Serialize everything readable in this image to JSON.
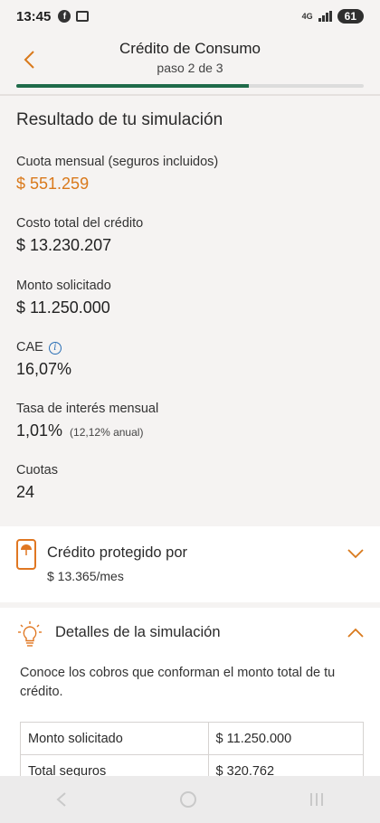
{
  "status_bar": {
    "time": "13:45",
    "network": "4G",
    "battery": "61",
    "icons": [
      "facebook-icon",
      "screenshot-icon",
      "signal-icon",
      "battery-icon"
    ]
  },
  "header": {
    "title": "Crédito de Consumo",
    "step": "paso 2 de 3",
    "progress_fraction": 0.67
  },
  "result": {
    "title": "Resultado de tu simulación",
    "fields": [
      {
        "label": "Cuota mensual (seguros incluidos)",
        "value": "$ 551.259"
      },
      {
        "label": "Costo total del crédito",
        "value": "$ 13.230.207"
      },
      {
        "label": "Monto solicitado",
        "value": "$ 11.250.000"
      },
      {
        "label": "CAE",
        "value": "16,07%"
      },
      {
        "label": "Tasa de interés mensual",
        "value": "1,01%",
        "note": "(12,12% anual)"
      },
      {
        "label": "Cuotas",
        "value": "24"
      }
    ]
  },
  "protection": {
    "title": "Crédito protegido por",
    "subtitle": "$ 13.365/mes"
  },
  "details": {
    "title": "Detalles de la simulación",
    "description": "Conoce los cobros que conforman el monto total de tu crédito.",
    "rows": [
      {
        "label": "Monto solicitado",
        "value": "$ 11.250.000"
      },
      {
        "label": "Total seguros",
        "value": "$ 320.762"
      }
    ]
  },
  "colors": {
    "accent": "#d9791b",
    "progress": "#1f6b4a",
    "info": "#2a6fb5"
  }
}
